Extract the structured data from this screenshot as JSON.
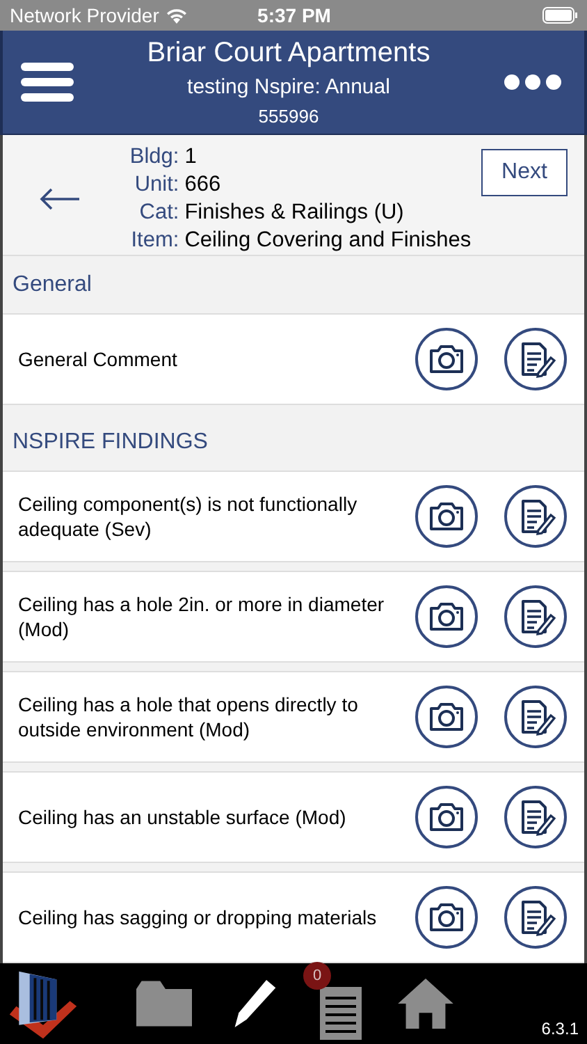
{
  "status_bar": {
    "carrier": "Network Provider",
    "time": "5:37 PM"
  },
  "header": {
    "title": "Briar Court Apartments",
    "subtitle": "testing Nspire: Annual",
    "number": "555996"
  },
  "location": {
    "fields": [
      {
        "label": "Bldg:",
        "value": "1"
      },
      {
        "label": "Unit:",
        "value": "666"
      },
      {
        "label": "Cat:",
        "value": "Finishes & Railings (U)"
      },
      {
        "label": "Item:",
        "value": "Ceiling Covering and Finishes"
      }
    ],
    "next_button": "Next"
  },
  "sections": [
    {
      "title": "General",
      "rows": [
        {
          "text": "General Comment"
        }
      ]
    },
    {
      "title": "NSPIRE FINDINGS",
      "rows": [
        {
          "text": "Ceiling component(s) is not functionally adequate (Sev)"
        },
        {
          "text": "Ceiling has a hole 2in. or more in diameter (Mod)"
        },
        {
          "text": "Ceiling has a hole that opens directly to outside environment (Mod)"
        },
        {
          "text": "Ceiling has an unstable surface (Mod)"
        },
        {
          "text": "Ceiling has sagging or dropping materials"
        }
      ]
    }
  ],
  "tab_bar": {
    "badge": "0",
    "version": "6.3.1"
  }
}
